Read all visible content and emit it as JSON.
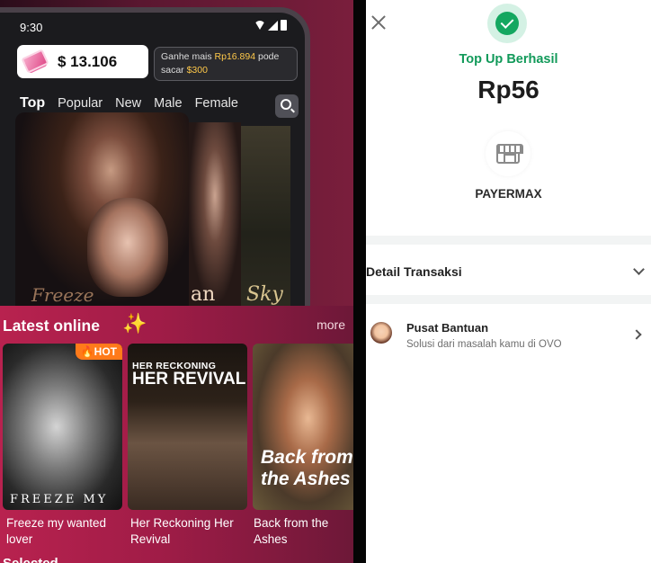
{
  "left_app": {
    "status": {
      "time": "9:30"
    },
    "balance": {
      "amount": "$ 13.106"
    },
    "earn_prompt": {
      "prefix": "Ganhe mais ",
      "highlight_amount": "Rp16.894",
      "middle": " pode sacar ",
      "highlight_cash": "$300"
    },
    "tabs": [
      {
        "label": "Top",
        "active": true
      },
      {
        "label": "Popular",
        "active": false
      },
      {
        "label": "New",
        "active": false
      },
      {
        "label": "Male",
        "active": false
      },
      {
        "label": "Female",
        "active": false
      }
    ],
    "banner_texts": {
      "b1": "Freeze",
      "b2": "an",
      "b3": "Sky"
    },
    "latest": {
      "title": "Latest online",
      "sparkle": "✨",
      "more_label": "more",
      "cards": [
        {
          "title": "Freeze my wanted lover",
          "cover_text": "FREEZE MY",
          "badge": "🔥HOT"
        },
        {
          "title": "Her Reckoning Her Revival",
          "cover_small": "HER RECKONING",
          "cover_big": "HER REVIVAL"
        },
        {
          "title": "Back from the Ashes",
          "cover_text": "Back from the Ashes"
        }
      ]
    },
    "selected_label": "Selected"
  },
  "payment": {
    "status_label": "Top Up Berhasil",
    "amount": "Rp56",
    "merchant": "PAYERMAX",
    "detail_label": "Detail Transaksi",
    "help": {
      "title": "Pusat Bantuan",
      "subtitle": "Solusi dari masalah kamu di OVO"
    },
    "colors": {
      "success": "#14a760",
      "success_text": "#129a5a"
    }
  }
}
